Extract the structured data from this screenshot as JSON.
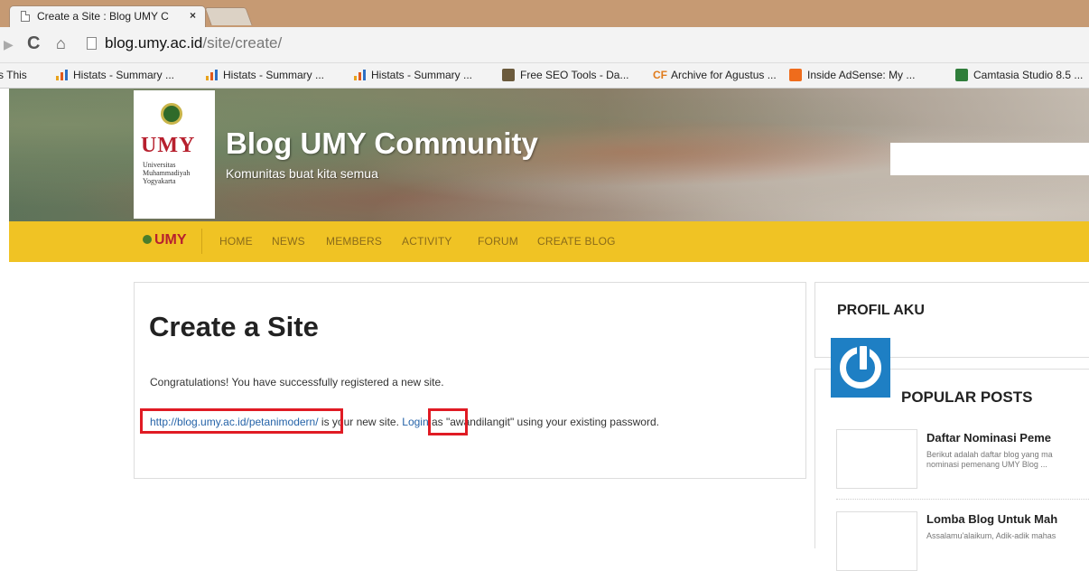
{
  "browser": {
    "tab_title": "Create a Site : Blog UMY C",
    "tab_close": "×",
    "url_host": "blog.umy.ac.id",
    "url_path": "/site/create/"
  },
  "bookmarks": [
    {
      "label": "s This"
    },
    {
      "label": "Histats - Summary ..."
    },
    {
      "label": "Histats - Summary ..."
    },
    {
      "label": "Histats - Summary ..."
    },
    {
      "label": "Free SEO Tools - Da..."
    },
    {
      "label": "Archive for Agustus ..."
    },
    {
      "label": "Inside AdSense: My ..."
    },
    {
      "label": "Camtasia Studio 8.5 ..."
    }
  ],
  "bookmark_icons": {
    "cf": "CF"
  },
  "logo": {
    "name": "UMY",
    "sub1": "Universitas",
    "sub2": "Muhammadiyah",
    "sub3": "Yogyakarta"
  },
  "site": {
    "title": "Blog UMY Community",
    "tagline": "Komunitas buat kita semua"
  },
  "nav": {
    "logo_text": "UMY",
    "items": [
      "HOME",
      "NEWS",
      "MEMBERS",
      "ACTIVITY",
      "FORUM",
      "CREATE BLOG"
    ]
  },
  "main": {
    "title": "Create a Site",
    "congrats": "Congratulations! You have successfully registered a new site.",
    "site_link": "http://blog.umy.ac.id/petanimodern/",
    "text_mid": " is your new site. ",
    "login_link": "Login",
    "text_end": " as \"awandilangit\" using your existing password."
  },
  "sidebar": {
    "profile_heading": "PROFIL AKU",
    "popular_heading": "POPULAR POSTS",
    "posts": [
      {
        "title": "Daftar Nominasi Peme",
        "excerpt1": "Berikut adalah daftar blog yang ma",
        "excerpt2": "nominasi pemenang UMY Blog ..."
      },
      {
        "title": "Lomba Blog Untuk Mah",
        "excerpt1": "Assalamu'alaikum, Adik-adik mahas",
        "excerpt2": ""
      }
    ]
  },
  "colors": {
    "nav_bg": "#f0c324",
    "brand_red": "#b7202e",
    "link": "#2563a8",
    "highlight": "#e01b24",
    "gravatar": "#1e7fc4"
  }
}
